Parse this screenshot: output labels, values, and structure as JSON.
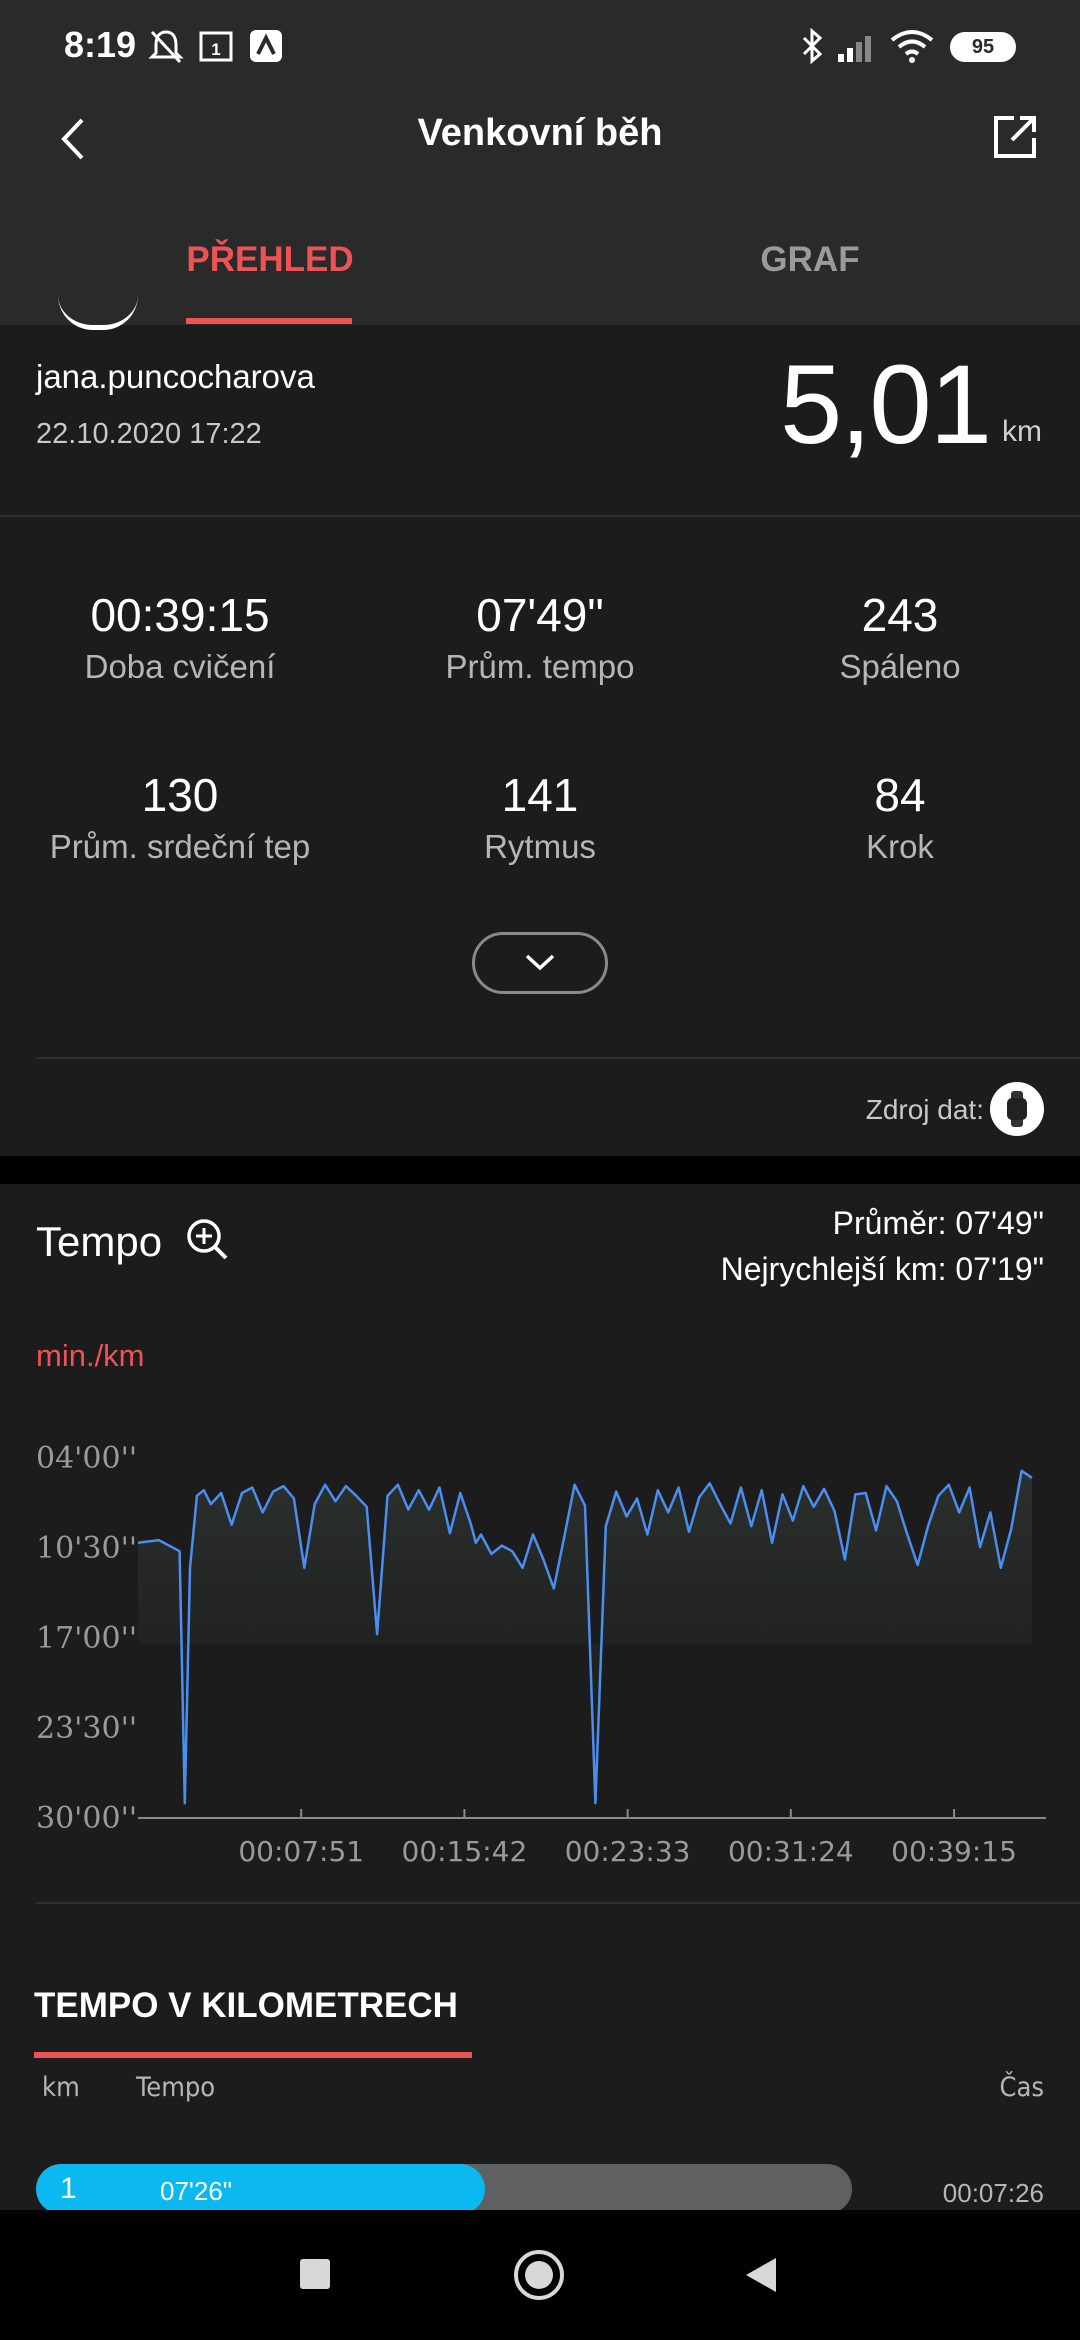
{
  "status_bar": {
    "time": "8:19",
    "battery": "95",
    "icons": [
      "bell-off-icon",
      "calendar-icon",
      "app-icon",
      "bluetooth-icon",
      "signal-icon",
      "wifi-icon",
      "battery-icon"
    ]
  },
  "header": {
    "title": "Venkovní běh",
    "back_icon": "back-arrow-icon",
    "share_icon": "share-icon"
  },
  "tabs": [
    {
      "label": "PŘEHLED",
      "active": true
    },
    {
      "label": "GRAF",
      "active": false
    }
  ],
  "summary": {
    "username": "jana.puncocharova",
    "datetime": "22.10.2020 17:22",
    "distance": "5,01",
    "distance_unit": "km"
  },
  "stats": [
    {
      "value": "00:39:15",
      "label": "Doba cvičení"
    },
    {
      "value": "07'49\"",
      "label": "Prům. tempo"
    },
    {
      "value": "243",
      "label": "Spáleno"
    },
    {
      "value": "130",
      "label": "Prům. srdeční tep"
    },
    {
      "value": "141",
      "label": "Rytmus"
    },
    {
      "value": "84",
      "label": "Krok"
    }
  ],
  "data_source": {
    "label": "Zdroj dat:"
  },
  "tempo": {
    "title": "Tempo",
    "average": "Průměr: 07'49\"",
    "fastest": "Nejrychlejší km: 07'19\"",
    "unit": "min./km"
  },
  "chart_data": {
    "type": "area",
    "title": "Tempo",
    "xlabel": "",
    "ylabel": "min./km",
    "y_tick_labels": [
      "04'00''",
      "10'30''",
      "17'00''",
      "23'30''",
      "30'00''"
    ],
    "x_tick_labels": [
      "00:07:51",
      "00:15:42",
      "00:23:33",
      "00:31:24",
      "00:39:15"
    ],
    "y_range_min_per_km": [
      4.0,
      30.0
    ],
    "y_inverted": true,
    "x_range_seconds": [
      0,
      2580
    ],
    "series": [
      {
        "color": "#4a8ef0",
        "x": [
          0,
          60,
          120,
          135,
          150,
          170,
          190,
          210,
          240,
          270,
          300,
          330,
          360,
          390,
          420,
          450,
          480,
          510,
          540,
          570,
          600,
          630,
          660,
          690,
          720,
          750,
          780,
          810,
          840,
          870,
          900,
          930,
          960,
          975,
          990,
          1020,
          1050,
          1080,
          1110,
          1140,
          1170,
          1200,
          1230,
          1260,
          1290,
          1320,
          1350,
          1380,
          1410,
          1440,
          1470,
          1500,
          1530,
          1560,
          1590,
          1620,
          1650,
          1680,
          1710,
          1740,
          1770,
          1800,
          1830,
          1860,
          1890,
          1920,
          1950,
          1980,
          2010,
          2040,
          2070,
          2100,
          2130,
          2160,
          2190,
          2220,
          2250,
          2280,
          2310,
          2340,
          2370,
          2400,
          2430,
          2460,
          2490,
          2520,
          2550,
          2580
        ],
        "values": [
          10.2,
          10.0,
          10.8,
          29.0,
          12.0,
          6.8,
          6.4,
          7.4,
          6.6,
          8.9,
          6.6,
          6.2,
          8.0,
          6.5,
          6.1,
          7.0,
          12.0,
          7.4,
          6.0,
          7.2,
          6.1,
          6.8,
          7.6,
          16.8,
          6.8,
          6.0,
          7.8,
          6.4,
          7.8,
          6.2,
          9.5,
          6.6,
          8.8,
          10.2,
          9.6,
          11.0,
          10.4,
          10.8,
          12.0,
          9.6,
          11.4,
          13.5,
          9.8,
          6.0,
          7.5,
          29.0,
          9.0,
          6.5,
          8.3,
          7.0,
          9.6,
          6.4,
          8.0,
          6.2,
          9.4,
          6.9,
          5.9,
          7.4,
          8.8,
          6.2,
          9.0,
          6.4,
          10.2,
          6.7,
          8.6,
          6.1,
          7.6,
          6.3,
          7.9,
          11.4,
          6.7,
          6.6,
          9.3,
          6.1,
          7.2,
          9.6,
          11.8,
          9.0,
          6.8,
          6.0,
          8.0,
          6.2,
          10.5,
          8.0,
          12.0,
          9.2,
          5.0,
          5.5
        ]
      }
    ],
    "grid": false
  },
  "km_table": {
    "title": "TEMPO V KILOMETRECH",
    "headers": {
      "km": "km",
      "tempo": "Tempo",
      "time": "Čas"
    },
    "rows": [
      {
        "km": "1",
        "tempo": "07'26\"",
        "time": "00:07:26",
        "fill_fraction": 0.55
      }
    ]
  },
  "nav": {
    "icons": [
      "recents-square-icon",
      "home-circle-icon",
      "back-triangle-icon"
    ]
  }
}
